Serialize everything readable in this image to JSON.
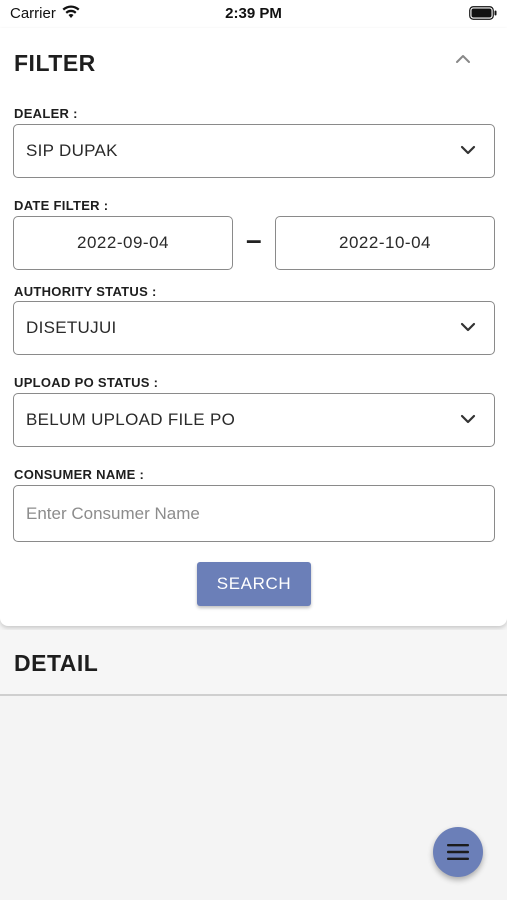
{
  "status_bar": {
    "carrier": "Carrier",
    "time": "2:39 PM"
  },
  "filter": {
    "title": "FILTER",
    "dealer": {
      "label": "DEALER :",
      "value": "SIP DUPAK"
    },
    "date_filter": {
      "label": "DATE FILTER :",
      "start": "2022-09-04",
      "separator": "–",
      "end": "2022-10-04"
    },
    "authority_status": {
      "label": "AUTHORITY STATUS :",
      "value": "DISETUJUI"
    },
    "upload_po_status": {
      "label": "UPLOAD PO STATUS :",
      "value": "BELUM UPLOAD FILE PO"
    },
    "consumer_name": {
      "label": "CONSUMER NAME :",
      "placeholder": "Enter Consumer Name",
      "value": ""
    },
    "search_label": "SEARCH"
  },
  "detail": {
    "title": "DETAIL"
  },
  "colors": {
    "accent": "#6b7fb8",
    "border": "#8a8a8a",
    "background": "#f4f4f4"
  },
  "icons": {
    "collapse": "chevron-up-icon",
    "dropdown": "chevron-down-icon",
    "fab": "menu-icon"
  }
}
